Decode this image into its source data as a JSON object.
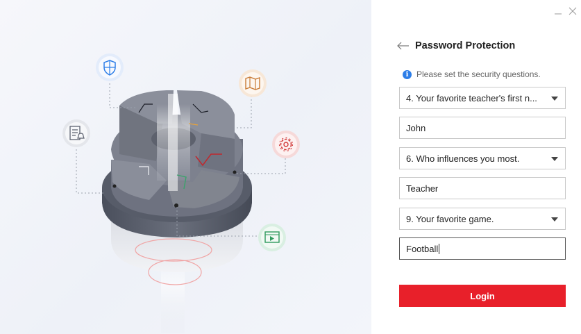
{
  "window": {
    "minimize_label": "—",
    "close_label": "✕"
  },
  "header": {
    "title": "Password Protection",
    "back_icon": "arrow-left-icon"
  },
  "info": {
    "text": "Please set the security questions."
  },
  "questions": [
    {
      "question": "4. Your favorite teacher's first n...",
      "answer": "John"
    },
    {
      "question": "6. Who influences you most.",
      "answer": "Teacher"
    },
    {
      "question": "9. Your favorite game.",
      "answer": "Football"
    }
  ],
  "login": {
    "label": "Login"
  },
  "colors": {
    "accent": "#e8202a",
    "info_blue": "#2d7ee8"
  },
  "illustration_icons": [
    "shield-icon",
    "map-icon",
    "document-bell-icon",
    "gear-icon",
    "video-icon"
  ]
}
